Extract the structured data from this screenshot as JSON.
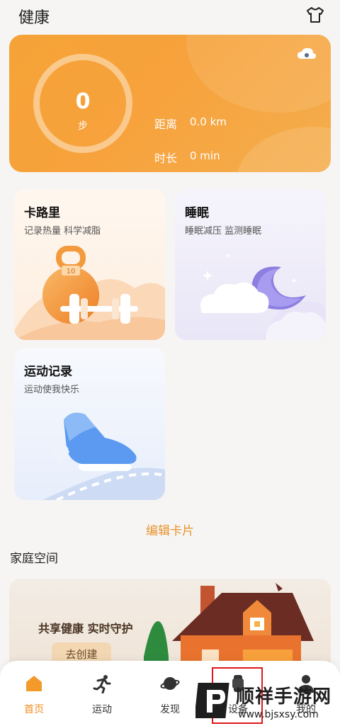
{
  "header": {
    "title": "健康",
    "shirt_icon": "tshirt-icon"
  },
  "step_card": {
    "steps": "0",
    "steps_unit": "步",
    "distance_label": "距离",
    "distance_value": "0.0 km",
    "duration_label": "时长",
    "duration_value": "0 min",
    "weather_icon": "cloud-weather-icon",
    "accent_color": "#f5a337"
  },
  "cards": {
    "calorie": {
      "title": "卡路里",
      "subtitle": "记录热量 科学减脂",
      "kettlebell_number": "10"
    },
    "sleep": {
      "title": "睡眠",
      "subtitle": "睡眠减压 监测睡眠"
    },
    "exercise": {
      "title": "运动记录",
      "subtitle": "运动使我快乐"
    }
  },
  "edit_card_label": "编辑卡片",
  "family": {
    "section_title": "家庭空间",
    "slogan": "共享健康 实时守护",
    "create_button": "去创建"
  },
  "bottom_nav": {
    "items": [
      {
        "label": "首页",
        "icon": "home-icon",
        "active": true
      },
      {
        "label": "运动",
        "icon": "running-icon",
        "active": false
      },
      {
        "label": "发现",
        "icon": "planet-icon",
        "active": false
      },
      {
        "label": "设备",
        "icon": "watch-icon",
        "active": false
      },
      {
        "label": "我的",
        "icon": "person-icon",
        "active": false
      }
    ],
    "active_color": "#f08c1a"
  },
  "watermark": {
    "text": "顺祥手游网",
    "url": "www.bjsxsy.com"
  }
}
